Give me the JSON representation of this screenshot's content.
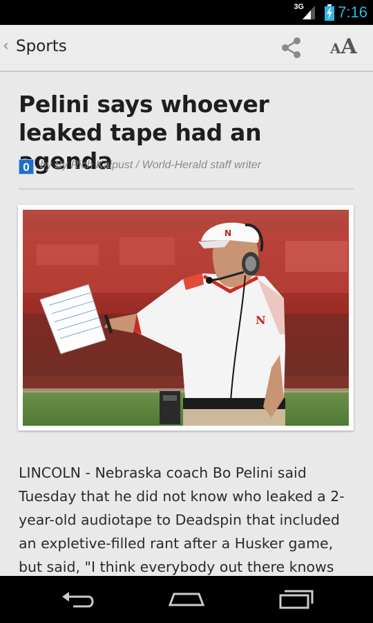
{
  "status_bar": {
    "network": "3G",
    "time": "7:16",
    "accent_color": "#33b5e5"
  },
  "action_bar": {
    "back_icon": "chevron-left-icon",
    "section_title": "Sports",
    "share_icon": "share-icon",
    "font_size_small": "A",
    "font_size_large": "A"
  },
  "article": {
    "headline": "Pelini says whoever leaked tape had an agenda",
    "source_badge": "0",
    "byline": "by By Rich Kaipust / World-Herald staff writer",
    "body": "LINCOLN - Nebraska coach Bo Pelini said Tuesday that he did not know who leaked a 2-year-old audiotape to Deadspin that included an expletive-filled rant after a Husker game, but said, \"I think everybody out there knows that"
  },
  "nav_bar": {
    "back_icon": "back-icon",
    "home_icon": "home-icon",
    "recents_icon": "recent-apps-icon"
  }
}
